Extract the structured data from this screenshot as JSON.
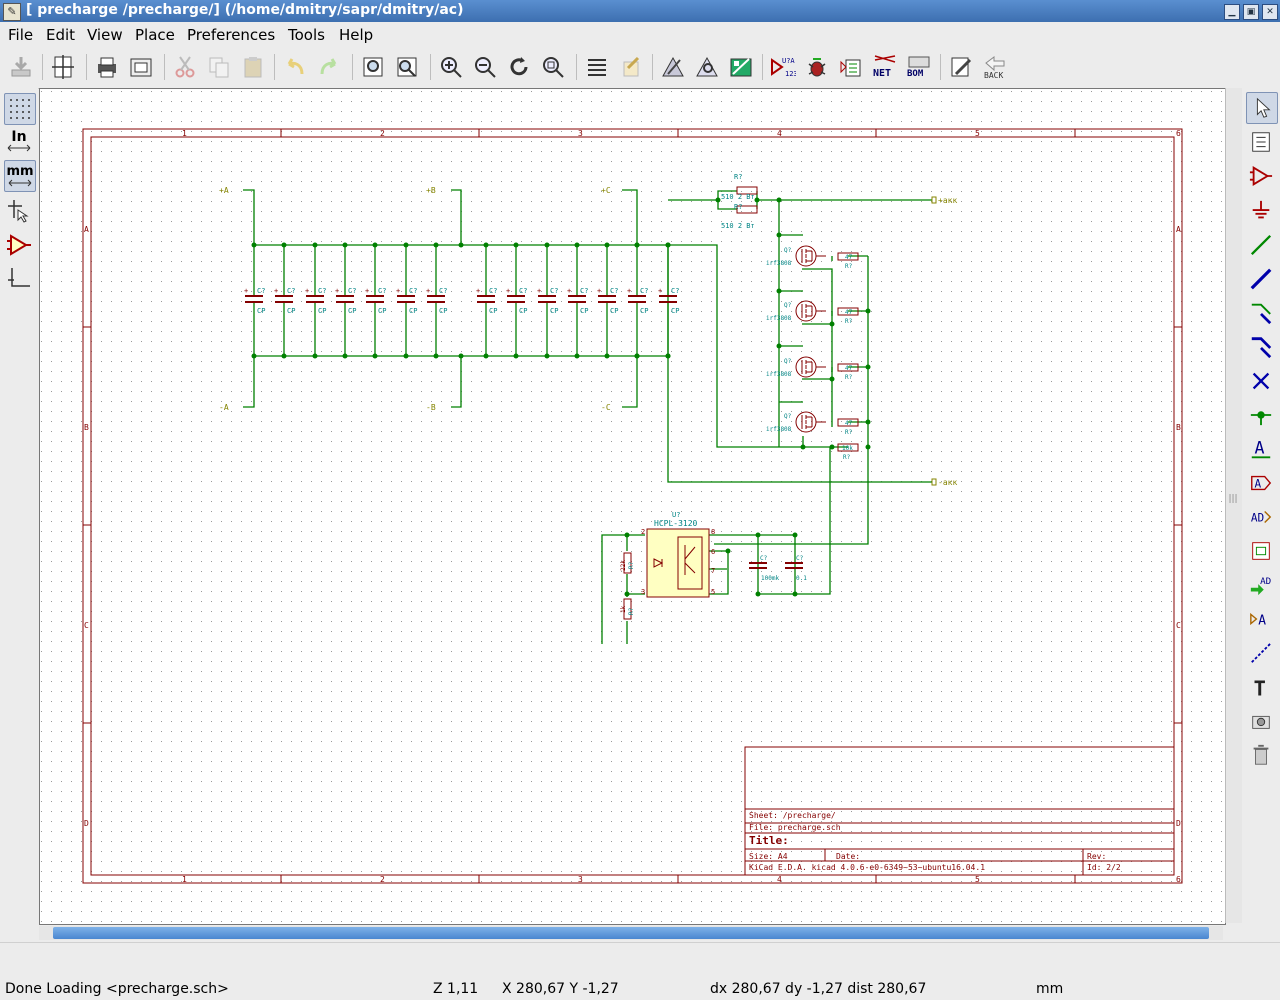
{
  "window": {
    "title": "[ precharge /precharge/] (/home/dmitry/sapr/dmitry/ac)",
    "buttons": {
      "minimize": "▁",
      "maximize": "▣",
      "close": "✕"
    }
  },
  "menu": [
    "File",
    "Edit",
    "View",
    "Place",
    "Preferences",
    "Tools",
    "Help"
  ],
  "toolbar": {
    "back_label": "BACK",
    "net_label": "NET",
    "bom_label": "BOM",
    "annotate_label": "U?A",
    "annotate_sub": "123"
  },
  "left_tools": {
    "units_in": "In",
    "units_mm": "mm"
  },
  "schematic": {
    "ports": {
      "ap": "+A",
      "bp": "+B",
      "cp": "+C",
      "an": "-A",
      "bn": "-B",
      "cn": "-C",
      "out_pos": "+акк",
      "out_neg": "-акк"
    },
    "cap_ref": "C?",
    "cap_val": "CP",
    "res_ref": "R?",
    "res_510": "510 2 Вт",
    "res_47": "47",
    "res_10k": "10k",
    "mosfet_ref": "Q?",
    "mosfet_val": "irf3808",
    "opto_ref": "U?",
    "opto_val": "HCPL-3120",
    "r_22k": "22k",
    "r_1k": "1k",
    "c_100": "100mk",
    "c_01": "0.1",
    "opto_pins": [
      "2",
      "3",
      "8",
      "6",
      "7",
      "5"
    ],
    "border_cols": [
      "1",
      "2",
      "3",
      "4",
      "5",
      "6"
    ],
    "border_rows": [
      "A",
      "B",
      "C",
      "D"
    ]
  },
  "title_block": {
    "sheet": "Sheet: /precharge/",
    "file": "File: precharge.sch",
    "title": "Title:",
    "size": "Size: A4",
    "date": "Date:",
    "rev": "Rev:",
    "kicad": "KiCad E.D.A.  kicad 4.0.6-e0-6349~53~ubuntu16.04.1",
    "id": "Id: 2/2"
  },
  "status": {
    "message": "Done Loading <precharge.sch>",
    "zoom": "Z 1,11",
    "xy": "X 280,67  Y -1,27",
    "dxy": "dx 280,67  dy -1,27  dist 280,67",
    "units": "mm"
  },
  "colors": {
    "wire": "#008000",
    "component": "#840000",
    "reference": "#008484",
    "port": "#848400",
    "sheet_border": "#840000",
    "opto_fill": "#ffffc2"
  }
}
